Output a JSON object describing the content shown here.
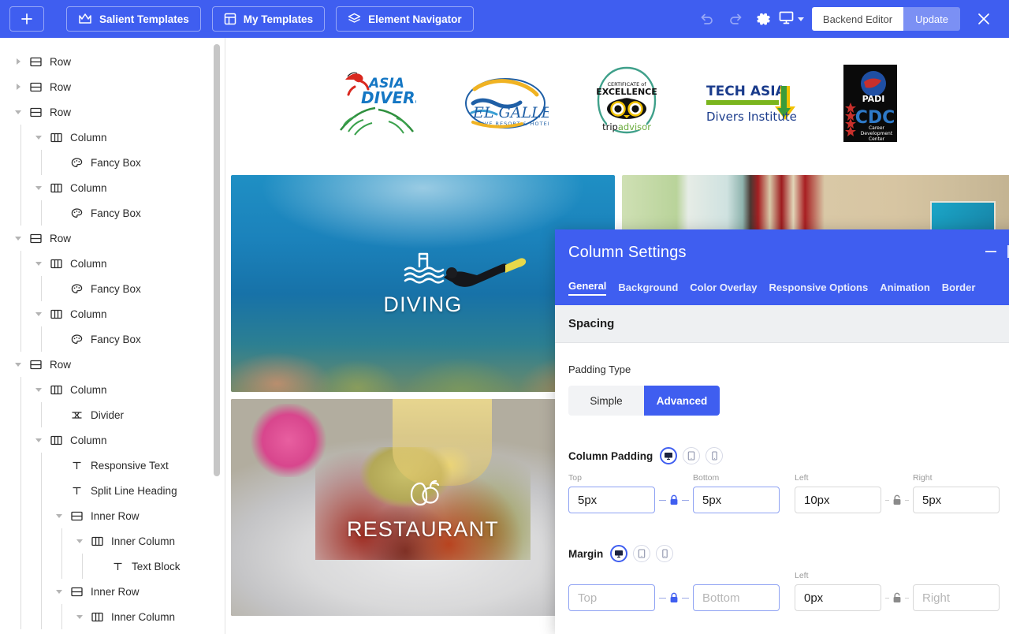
{
  "toolbar": {
    "add_label": "+",
    "salient_templates": "Salient Templates",
    "my_templates": "My Templates",
    "element_navigator": "Element Navigator",
    "backend_editor": "Backend Editor",
    "update": "Update",
    "accent": "#3f5ef0"
  },
  "sidebar": {
    "items": [
      {
        "label": "Row",
        "icon": "row-icon",
        "depth": 0,
        "twisty": "right"
      },
      {
        "label": "Row",
        "icon": "row-icon",
        "depth": 0,
        "twisty": "right"
      },
      {
        "label": "Row",
        "icon": "row-icon",
        "depth": 0,
        "twisty": "down"
      },
      {
        "label": "Column",
        "icon": "column-icon",
        "depth": 1,
        "twisty": "down"
      },
      {
        "label": "Fancy Box",
        "icon": "fancy-box-icon",
        "depth": 2,
        "twisty": "none"
      },
      {
        "label": "Column",
        "icon": "column-icon",
        "depth": 1,
        "twisty": "down"
      },
      {
        "label": "Fancy Box",
        "icon": "fancy-box-icon",
        "depth": 2,
        "twisty": "none"
      },
      {
        "label": "Row",
        "icon": "row-icon",
        "depth": 0,
        "twisty": "down"
      },
      {
        "label": "Column",
        "icon": "column-icon",
        "depth": 1,
        "twisty": "down"
      },
      {
        "label": "Fancy Box",
        "icon": "fancy-box-icon",
        "depth": 2,
        "twisty": "none"
      },
      {
        "label": "Column",
        "icon": "column-icon",
        "depth": 1,
        "twisty": "down"
      },
      {
        "label": "Fancy Box",
        "icon": "fancy-box-icon",
        "depth": 2,
        "twisty": "none"
      },
      {
        "label": "Row",
        "icon": "row-icon",
        "depth": 0,
        "twisty": "down"
      },
      {
        "label": "Column",
        "icon": "column-icon",
        "depth": 1,
        "twisty": "down"
      },
      {
        "label": "Divider",
        "icon": "divider-icon",
        "depth": 2,
        "twisty": "none"
      },
      {
        "label": "Column",
        "icon": "column-icon",
        "depth": 1,
        "twisty": "down"
      },
      {
        "label": "Responsive Text",
        "icon": "text-icon",
        "depth": 2,
        "twisty": "none"
      },
      {
        "label": "Split Line Heading",
        "icon": "text-icon",
        "depth": 2,
        "twisty": "none"
      },
      {
        "label": "Inner Row",
        "icon": "row-icon",
        "depth": 2,
        "twisty": "down"
      },
      {
        "label": "Inner Column",
        "icon": "column-icon",
        "depth": 3,
        "twisty": "down"
      },
      {
        "label": "Text Block",
        "icon": "text-icon",
        "depth": 4,
        "twisty": "none"
      },
      {
        "label": "Inner Row",
        "icon": "row-icon",
        "depth": 2,
        "twisty": "down"
      },
      {
        "label": "Inner Column",
        "icon": "column-icon",
        "depth": 3,
        "twisty": "down"
      }
    ]
  },
  "canvas": {
    "logos": [
      {
        "name": "asia-divers-logo",
        "text": "ASIA DIVERS"
      },
      {
        "name": "el-galleon-logo",
        "text": "EL GALLEON"
      },
      {
        "name": "tripadvisor-certificate-logo",
        "text": "CERTIFICATE of EXCELLENCE tripadvisor"
      },
      {
        "name": "tech-asia-divers-institute-logo",
        "text": "TECH ASIA Divers Institute"
      },
      {
        "name": "padi-cdc-logo",
        "text": "PADI CDC Career Development Center"
      }
    ],
    "tiles": [
      {
        "name": "diving-tile",
        "caption": "DIVING",
        "icon": "pool-icon"
      },
      {
        "name": "room-tile",
        "caption": "",
        "icon": ""
      },
      {
        "name": "restaurant-tile",
        "caption": "RESTAURANT",
        "icon": "food-icon"
      }
    ]
  },
  "panel": {
    "title": "Column Settings",
    "tabs": [
      {
        "label": "General",
        "active": true
      },
      {
        "label": "Background",
        "active": false
      },
      {
        "label": "Color Overlay",
        "active": false
      },
      {
        "label": "Responsive Options",
        "active": false
      },
      {
        "label": "Animation",
        "active": false
      },
      {
        "label": "Border",
        "active": false
      }
    ],
    "section_title": "Spacing",
    "padding_type": {
      "label": "Padding Type",
      "options": [
        "Simple",
        "Advanced"
      ],
      "selected": "Advanced"
    },
    "column_padding": {
      "label": "Column Padding",
      "devices": [
        "desktop-icon",
        "tablet-icon",
        "mobile-icon"
      ],
      "selected_device": "desktop-icon",
      "fields": [
        {
          "caption": "Top",
          "value": "5px",
          "placeholder": "Top",
          "state": "blue"
        },
        {
          "caption": "Bottom",
          "value": "5px",
          "placeholder": "Bottom",
          "state": "blue"
        },
        {
          "caption": "Left",
          "value": "10px",
          "placeholder": "Left",
          "state": "grey"
        },
        {
          "caption": "Right",
          "value": "5px",
          "placeholder": "Right",
          "state": "grey"
        }
      ],
      "link_tb": "locked",
      "link_lr": "unlocked"
    },
    "margin": {
      "label": "Margin",
      "devices": [
        "desktop-icon",
        "tablet-icon",
        "mobile-icon"
      ],
      "selected_device": "desktop-icon",
      "fields": [
        {
          "caption": "",
          "value": "",
          "placeholder": "Top",
          "state": "blue"
        },
        {
          "caption": "",
          "value": "",
          "placeholder": "Bottom",
          "state": "blue"
        },
        {
          "caption": "Left",
          "value": "0px",
          "placeholder": "Left",
          "state": "grey"
        },
        {
          "caption": "",
          "value": "",
          "placeholder": "Right",
          "state": "grey"
        }
      ],
      "link_tb": "locked",
      "link_lr": "unlocked"
    }
  }
}
